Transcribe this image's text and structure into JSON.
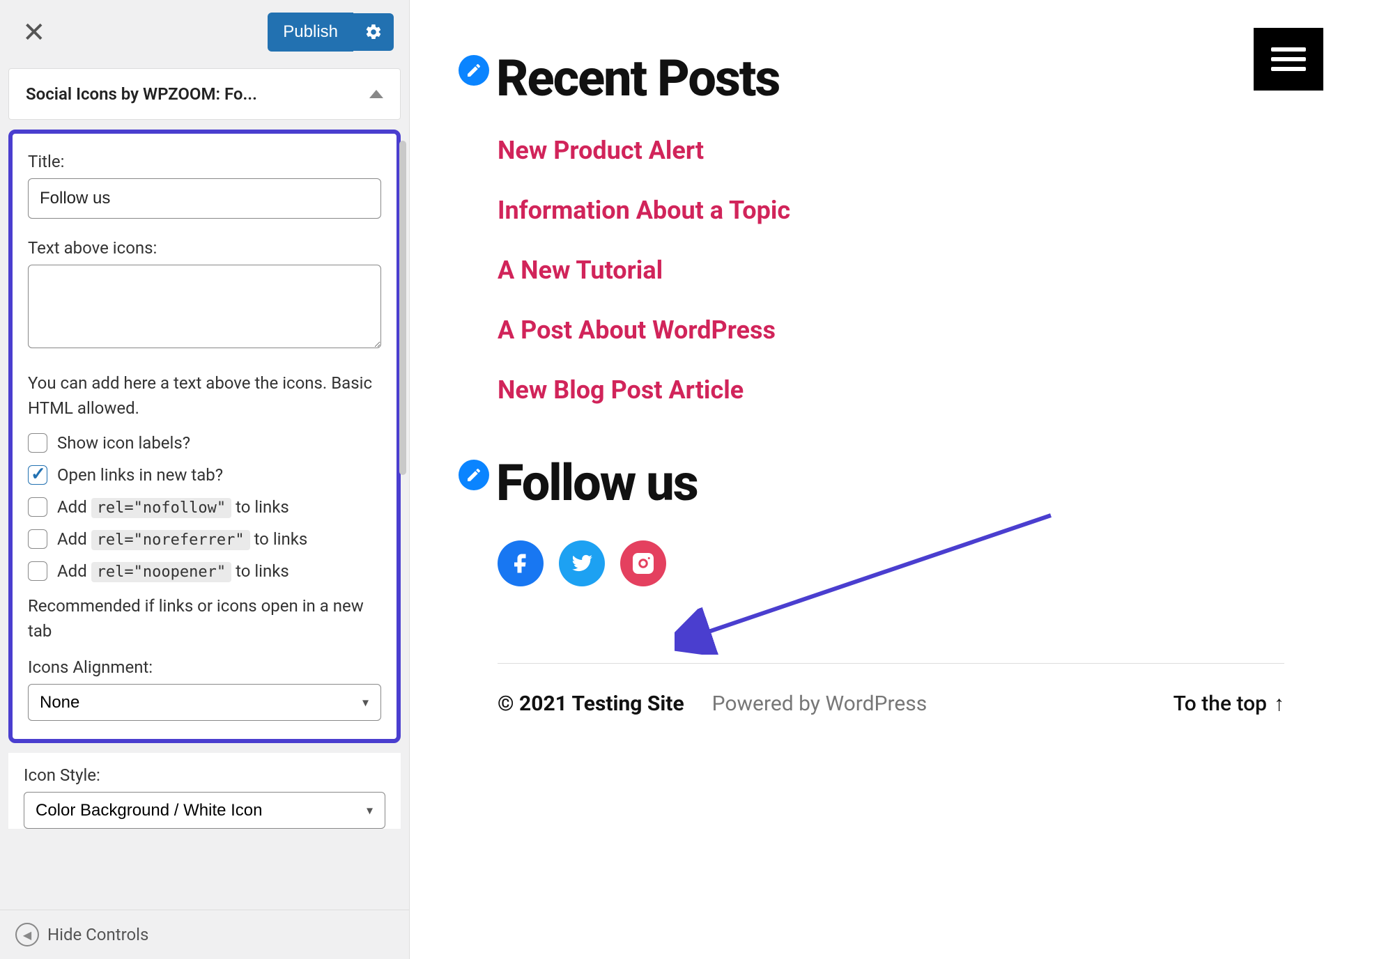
{
  "sidebar": {
    "publish_label": "Publish",
    "accordion_title": "Social Icons by WPZOOM: Fo...",
    "title_label": "Title:",
    "title_value": "Follow us",
    "text_above_label": "Text above icons:",
    "text_above_value": "",
    "help_text": "You can add here a text above the icons. Basic HTML allowed.",
    "checks": {
      "show_labels": {
        "label": "Show icon labels?",
        "checked": false
      },
      "new_tab": {
        "label": "Open links in new tab?",
        "checked": true
      },
      "nofollow": {
        "prefix": "Add ",
        "code": "rel=\"nofollow\"",
        "suffix": " to links",
        "checked": false
      },
      "noreferrer": {
        "prefix": "Add ",
        "code": "rel=\"noreferrer\"",
        "suffix": " to links",
        "checked": false
      },
      "noopener": {
        "prefix": "Add ",
        "code": "rel=\"noopener\"",
        "suffix": " to links",
        "checked": false
      }
    },
    "recommended_text": "Recommended if links or icons open in a new tab",
    "alignment_label": "Icons Alignment:",
    "alignment_value": "None",
    "iconstyle_label": "Icon Style:",
    "iconstyle_value": "Color Background / White Icon",
    "hide_controls": "Hide Controls"
  },
  "preview": {
    "recent_posts_heading": "Recent Posts",
    "posts": [
      "New Product Alert",
      "Information About a Topic",
      "A New Tutorial",
      "A Post About WordPress",
      "New Blog Post Article"
    ],
    "follow_heading": "Follow us",
    "social": [
      "facebook",
      "twitter",
      "instagram"
    ],
    "footer_copy": "© 2021 Testing Site",
    "footer_powered": "Powered by WordPress",
    "footer_totop": "To the top"
  }
}
